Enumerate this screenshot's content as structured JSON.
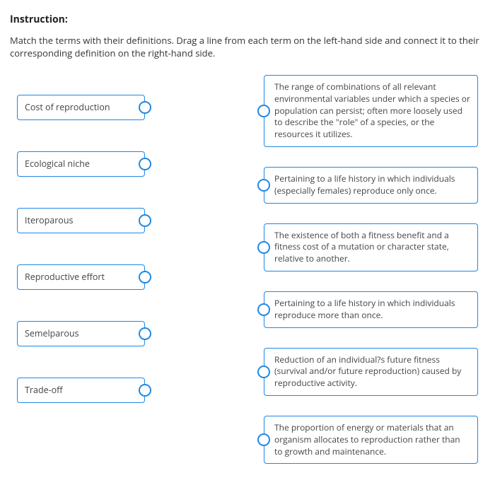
{
  "instruction": {
    "heading": "Instruction:",
    "text": "Match the terms with their definitions. Drag a line from each term on the left-hand side and connect it to their corresponding definition on the right-hand side."
  },
  "terms": [
    "Cost of reproduction",
    "Ecological niche",
    "Iteroparous",
    "Reproductive effort",
    "Semelparous",
    "Trade-off"
  ],
  "definitions": [
    "The range of combinations of all relevant environmental variables under which a species or population can persist; often more loosely used to describe the \"role\" of a species, or the resources it utilizes.",
    "Pertaining to a life history in which individuals (especially females) reproduce only once.",
    "The existence of both a fitness benefit and a fitness cost of a mutation or character state, relative to another.",
    "Pertaining to a life history in which individuals reproduce more than once.",
    "Reduction of an individual?s future fitness (survival and/or future reproduction) caused by reproductive activity.",
    "The proportion of energy or materials that an organism allocates to reproduction rather than to growth and maintenance."
  ]
}
